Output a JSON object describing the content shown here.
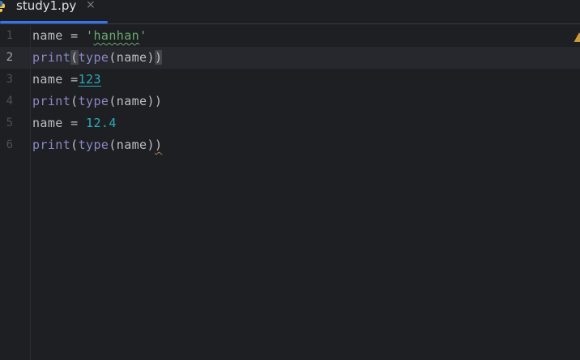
{
  "tab": {
    "filename": "study1.py",
    "close_glyph": "×",
    "icon": "python-file-icon"
  },
  "colors": {
    "background": "#1e1f22",
    "current_line": "#26282e",
    "tab_underline": "#3574f0",
    "identifier": "#bcbec4",
    "string": "#6aab73",
    "number": "#2aacb8",
    "builtin": "#8888c6",
    "line_number": "#4b5059",
    "warning": "#c99a3a"
  },
  "editor": {
    "current_line": 2,
    "lines": [
      {
        "number": "1",
        "tokens": [
          {
            "text": "name",
            "kind": "ident"
          },
          {
            "text": " = ",
            "kind": "op"
          },
          {
            "text": "'",
            "kind": "str"
          },
          {
            "text": "hanhan",
            "kind": "str-typo"
          },
          {
            "text": "'",
            "kind": "str"
          }
        ]
      },
      {
        "number": "2",
        "tokens": [
          {
            "text": "print",
            "kind": "builtin"
          },
          {
            "text": "(",
            "kind": "paren-match"
          },
          {
            "text": "type",
            "kind": "builtin"
          },
          {
            "text": "(",
            "kind": "paren"
          },
          {
            "text": "name",
            "kind": "ident"
          },
          {
            "text": ")",
            "kind": "paren"
          },
          {
            "text": ")",
            "kind": "paren-match"
          }
        ]
      },
      {
        "number": "3",
        "tokens": [
          {
            "text": "name",
            "kind": "ident"
          },
          {
            "text": " =",
            "kind": "op"
          },
          {
            "text": "123",
            "kind": "num-warn"
          }
        ]
      },
      {
        "number": "4",
        "tokens": [
          {
            "text": "print",
            "kind": "builtin"
          },
          {
            "text": "(",
            "kind": "paren"
          },
          {
            "text": "type",
            "kind": "builtin"
          },
          {
            "text": "(",
            "kind": "paren"
          },
          {
            "text": "name",
            "kind": "ident"
          },
          {
            "text": "))",
            "kind": "paren"
          }
        ]
      },
      {
        "number": "5",
        "tokens": [
          {
            "text": "name",
            "kind": "ident"
          },
          {
            "text": " = ",
            "kind": "op"
          },
          {
            "text": "12.4",
            "kind": "num"
          }
        ]
      },
      {
        "number": "6",
        "tokens": [
          {
            "text": "print",
            "kind": "builtin"
          },
          {
            "text": "(",
            "kind": "paren"
          },
          {
            "text": "type",
            "kind": "builtin"
          },
          {
            "text": "(",
            "kind": "paren"
          },
          {
            "text": "name",
            "kind": "ident"
          },
          {
            "text": ")",
            "kind": "paren"
          },
          {
            "text": ")",
            "kind": "paren-weak"
          }
        ]
      }
    ]
  },
  "inspection": {
    "icon": "warning-icon"
  }
}
